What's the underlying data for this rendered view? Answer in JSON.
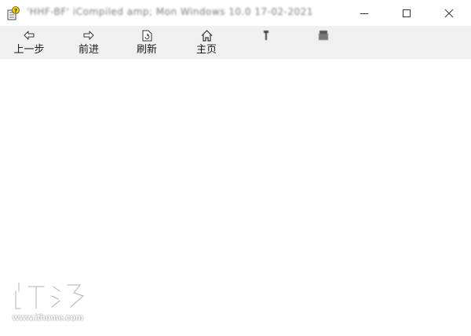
{
  "window": {
    "title": "'HHF-BF' iCompiled amp; Mon Windows 10.0 17-02-2021"
  },
  "toolbar": {
    "back_label": "上一步",
    "forward_label": "前进",
    "refresh_label": "刷新",
    "home_label": "主页",
    "options_label": "",
    "about_label": ""
  },
  "watermark": {
    "url": "www.ithome.com"
  }
}
